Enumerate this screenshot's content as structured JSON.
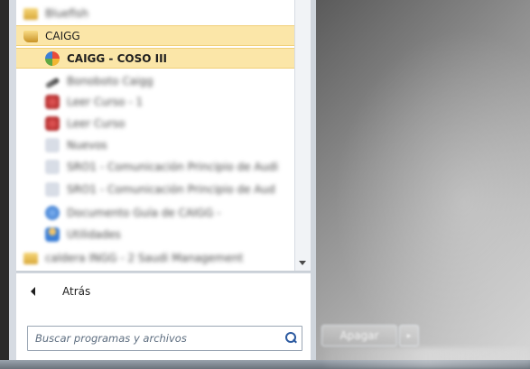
{
  "start_menu": {
    "items": [
      {
        "label": "Bluefish",
        "icon": "folder-icon",
        "blurred": true,
        "selected": false,
        "indent": 0
      },
      {
        "label": "CAIGG",
        "icon": "folder-open-icon",
        "blurred": false,
        "selected": true,
        "indent": 0
      },
      {
        "label": "CAIGG - COSO III",
        "icon": "caigg-app-icon",
        "blurred": false,
        "selected": true,
        "indent": 1
      },
      {
        "label": "Bonoboto Caigg",
        "icon": "tool-icon",
        "blurred": true,
        "selected": false,
        "indent": 1
      },
      {
        "label": "Leer Curso - 1",
        "icon": "red-app-icon",
        "blurred": true,
        "selected": false,
        "indent": 1
      },
      {
        "label": "Leer Curso",
        "icon": "red-app-icon",
        "blurred": true,
        "selected": false,
        "indent": 1
      },
      {
        "label": "Nuevos",
        "icon": "pale-doc-icon",
        "blurred": true,
        "selected": false,
        "indent": 1
      },
      {
        "label": "SRO1 - Comunicación Principio de Audi",
        "icon": "pale-doc-icon",
        "blurred": true,
        "selected": false,
        "indent": 1
      },
      {
        "label": "SRO1 - Comunicación Principio de Aud",
        "icon": "pale-doc-icon",
        "blurred": true,
        "selected": false,
        "indent": 1
      },
      {
        "label": "Documento Guía de CAIGG -",
        "icon": "blue-doc-icon",
        "blurred": true,
        "selected": false,
        "indent": 1
      },
      {
        "label": "Utilidades",
        "icon": "person-icon",
        "blurred": true,
        "selected": false,
        "indent": 1
      },
      {
        "label": "caldera INGG - 2 Saudi Management",
        "icon": "folder-icon",
        "blurred": true,
        "selected": false,
        "indent": 0
      }
    ],
    "back_label": "Atrás",
    "search_placeholder": "Buscar programas y archivos",
    "shutdown_label": "Apagar",
    "shutdown_arrow": "▸"
  },
  "colors": {
    "selected_bg": "#fbe6a8",
    "search_icon": "#2c5aa0"
  }
}
